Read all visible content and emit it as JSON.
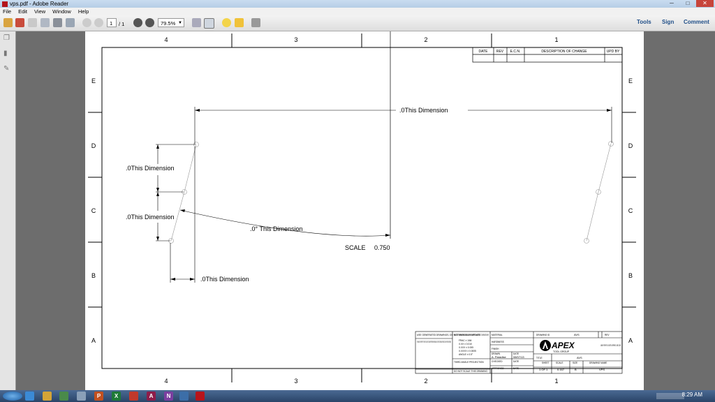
{
  "window": {
    "title": "vps.pdf - Adobe Reader",
    "minimize": "─",
    "maximize": "□",
    "close": "✕"
  },
  "menu": [
    "File",
    "Edit",
    "View",
    "Window",
    "Help"
  ],
  "toolbar": {
    "page_current": "1",
    "page_total": "/ 1",
    "zoom": "79.5%",
    "right_links": [
      "Tools",
      "Sign",
      "Comment"
    ]
  },
  "drawing": {
    "zone_cols": [
      "4",
      "3",
      "2",
      "1"
    ],
    "zone_rows": [
      "E",
      "D",
      "C",
      "B",
      "A"
    ],
    "revision_headers": [
      "DATE",
      "REV",
      "E.C.N.",
      "DESCRIPTION OF CHANGE",
      "UPD BY"
    ],
    "dimensions": {
      "top": ".0This Dimension",
      "left_upper": ".0This Dimension",
      "left_lower": ".0This Dimension",
      "angle": ".0°  This Dimension",
      "bottom": ".0This Dimension"
    },
    "scale_label": "SCALE",
    "scale_value": "0.750",
    "title_block": {
      "notice": "USE GENERATED DRAWINGS, DO NOT MANUALLY UPDATE",
      "proprietary": "THIS DRAWING IS THE PROPERTY OF THE APEX TOOL GROUP. IT CONTAINS PROPRIETARY INFORMATION AND IS TO BE KEPT CONFIDENTIAL. REPRODUCTION OF ANY PORTION IS FORBIDDEN",
      "tolerances": "UNLESS OTHERWISE SPECIFIED DIMENSIONS ARE IN INCHES & TOLERANCES ARE:",
      "tol_values": [
        "FRAC ± 1/64",
        "X.XX ± 0.010",
        "X.XXX ± 0.005",
        "X.XXXX ± 0.0005",
        "ANGLE ± 0.5°"
      ],
      "material": "MATERIAL",
      "hardness": "HARDNESS",
      "finish": "FINISH",
      "drawn": "DRAWN",
      "drawn_by": "A. Paradise",
      "date": "DATE",
      "date_value": "08/07/13",
      "checked": "CHECKED",
      "approved": "APPROVED",
      "projection": "THIRD ANGLE PROJECTION",
      "do_not_scale": "DO NOT SCALE THIS DRAWING",
      "drawing_id_label": "DRAWING ID",
      "drawing_id": "AVS",
      "rev_label": "REV",
      "logo": "APEX",
      "logo_sub": "TOOL GROUP",
      "address": "14600 YORK RD. SUITE A SPARKS, MD 21152",
      "title_label": "TITLE",
      "title_value": "AVS",
      "sheet_label": "SHEET",
      "sheet_value": "1 OF 1",
      "scale_label": "SCALE",
      "scale_value": "0.167",
      "size_label": "SIZE",
      "size_value": "B",
      "drawing_name_label": "DRAWING NAME",
      "drawing_name": "VPS"
    }
  },
  "taskbar": {
    "clock": "8:29 AM"
  }
}
